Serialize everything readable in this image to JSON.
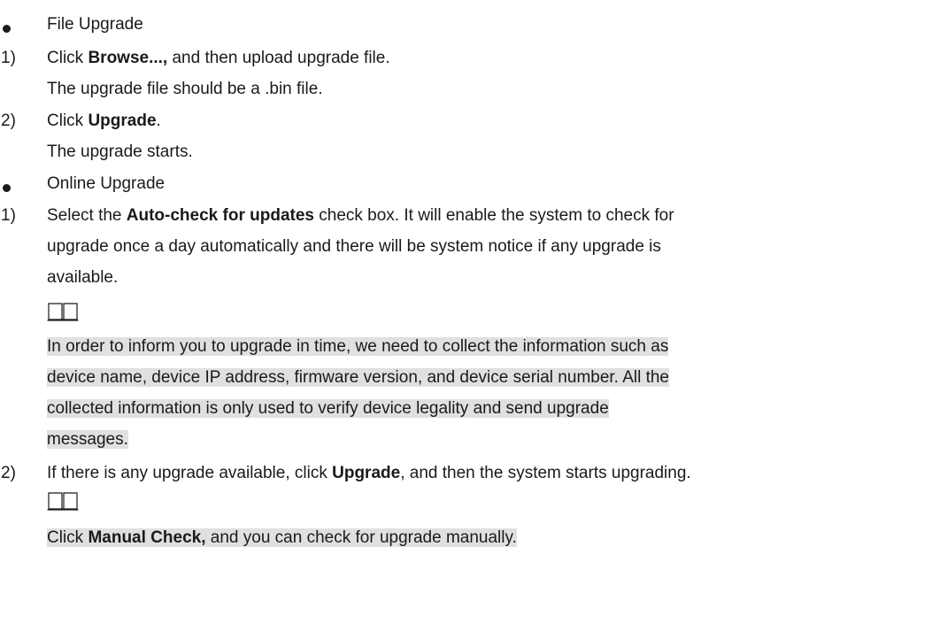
{
  "items": {
    "file_upgrade": "File Upgrade",
    "step1_pre": "Click ",
    "step1_bold": "Browse...,",
    "step1_post": " and then upload upgrade file.",
    "step1_detail": "The upgrade file should be a .bin file.",
    "step2_marker": "2)",
    "step2_pre": "Click ",
    "step2_bold": "Upgrade",
    "step2_post": ".",
    "step2_detail": "The upgrade starts.",
    "online_upgrade": "Online Upgrade",
    "online1_pre": "Select the ",
    "online1_bold": "Auto-check for updates",
    "online1_post": " check box. It will enable the system to check for",
    "online1_line2": "upgrade once a day automatically and there will be system notice if any upgrade is",
    "online1_line3": "available.",
    "note1_line1": "In order to inform you to upgrade in time, we need to collect the information such as",
    "note1_line2": "device name, device IP address, firmware version, and device serial number. All the",
    "note1_line3": "collected information is only used to verify device legality and send upgrade",
    "note1_line4": "messages.",
    "online2_pre": "If there is any upgrade available, click ",
    "online2_bold": "Upgrade",
    "online2_post": ", and then the system starts upgrading.",
    "note2_pre": "Click ",
    "note2_bold": "Manual Check,",
    "note2_post": " and you can check for upgrade manually.",
    "marker_1": "1)",
    "marker_2": "2)"
  }
}
